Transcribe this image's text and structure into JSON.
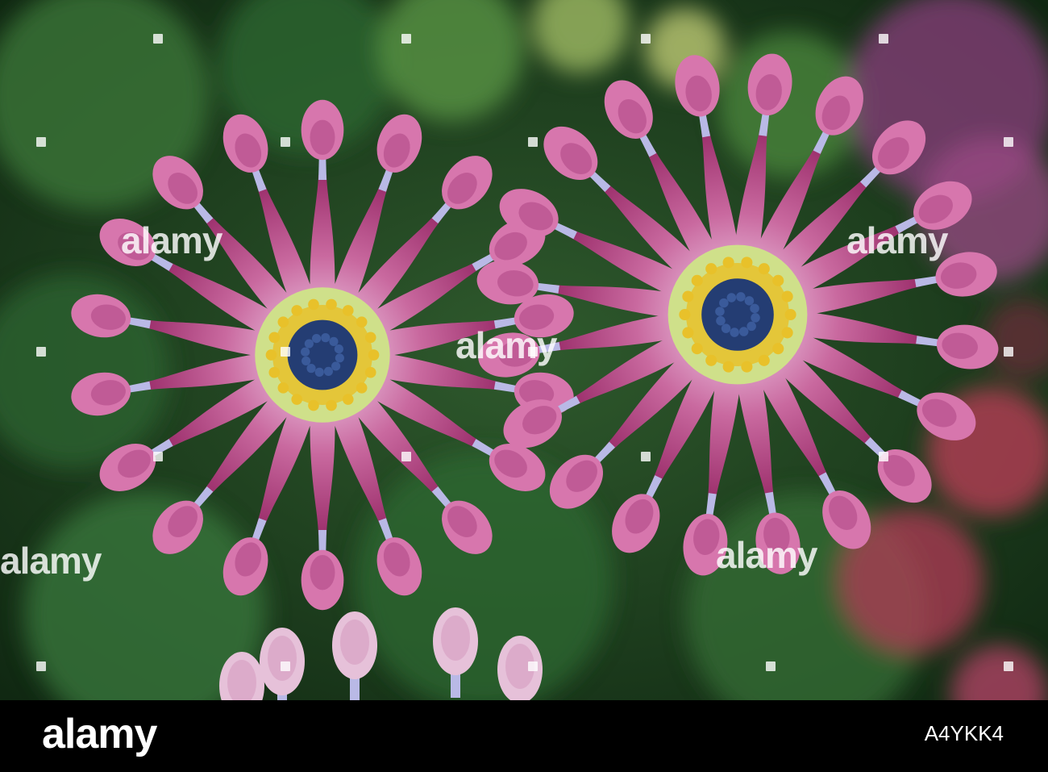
{
  "photo": {
    "subject": "two-purple-spoon-petal-daisies",
    "colors": {
      "background_green": "#1d3a1f",
      "petal_magenta": "#b2457f",
      "petal_tip_pink": "#d776ad",
      "petal_tube_lavender": "#b9b9e6",
      "center_navy": "#243d73",
      "pollen_yellow": "#e8c12a",
      "pollen_green": "#cfe08a"
    }
  },
  "watermark": {
    "text": "alamy"
  },
  "footer": {
    "logo": "alamy",
    "image_id": "A4YKK4"
  }
}
